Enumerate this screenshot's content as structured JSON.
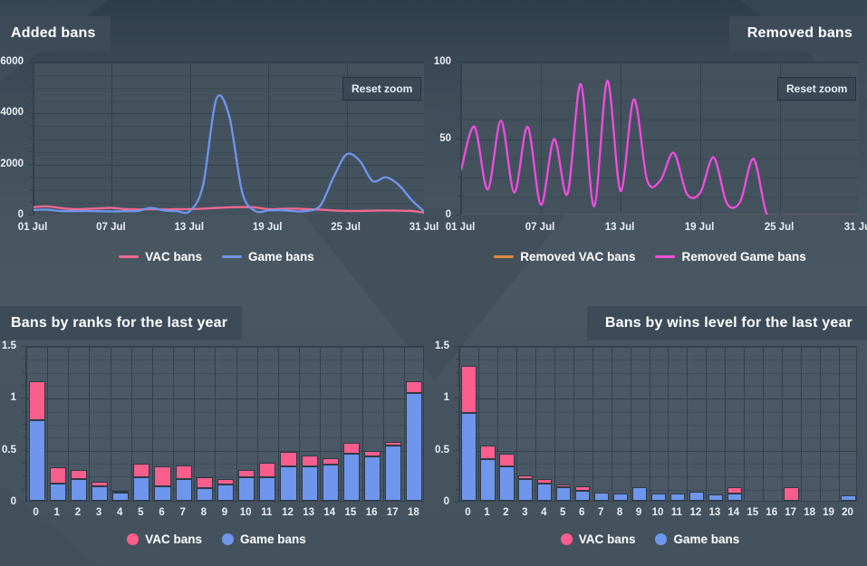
{
  "theme": {
    "page_bg": "#46545f",
    "panel_title_bg": "#3d4b59",
    "plot_bg_line": "#44525e",
    "plot_bg_bar": "#4b5966",
    "grid": "#33414e",
    "text": "#ffffff",
    "vac_color": "#f4traits",
    "colors": {
      "vac_line": "#f2698f",
      "game_line": "#6e96ed",
      "removed_vac_line": "#e08a3c",
      "removed_game_line": "#f24ce0",
      "vac_bar": "#fa5e8c",
      "game_bar": "#6e96ed"
    }
  },
  "panels": {
    "added_bans": {
      "title": "Added bans",
      "title_align": "left",
      "reset_button": "Reset zoom"
    },
    "removed_bans": {
      "title": "Removed bans",
      "title_align": "right",
      "reset_button": "Reset zoom"
    },
    "bans_by_ranks": {
      "title": "Bans by ranks for the last year",
      "title_align": "left"
    },
    "bans_by_wins": {
      "title": "Bans by wins level for the last year",
      "title_align": "right"
    }
  },
  "chart_data": [
    {
      "id": "added_bans",
      "type": "line",
      "title": "Added bans",
      "xlabel": "",
      "ylabel": "",
      "ylim": [
        0,
        6000
      ],
      "yticks": [
        0,
        2000,
        4000,
        6000
      ],
      "ytick_labels": [
        "0",
        "2000",
        "4000",
        "6000"
      ],
      "y_minor_step": 500,
      "xticks": [
        1,
        7,
        13,
        19,
        25,
        31
      ],
      "xtick_labels": [
        "01 Jul",
        "07 Jul",
        "13 Jul",
        "19 Jul",
        "25 Jul",
        "31 Jul"
      ],
      "grid": true,
      "legend_position": "bottom",
      "legend_marker": "line",
      "x": [
        1,
        2,
        3,
        4,
        5,
        6,
        7,
        8,
        9,
        10,
        11,
        12,
        13,
        14,
        15,
        16,
        17,
        18,
        19,
        20,
        21,
        22,
        23,
        24,
        25,
        26,
        27,
        28,
        29,
        30,
        31
      ],
      "series": [
        {
          "name": "VAC bans",
          "color": "#f2698f",
          "values": [
            330,
            360,
            300,
            250,
            260,
            280,
            300,
            250,
            240,
            250,
            240,
            250,
            250,
            270,
            300,
            320,
            330,
            320,
            250,
            260,
            270,
            250,
            230,
            200,
            180,
            180,
            190,
            200,
            190,
            180,
            110
          ]
        },
        {
          "name": "Game bans",
          "color": "#6e96ed",
          "values": [
            220,
            230,
            180,
            170,
            180,
            170,
            160,
            170,
            180,
            300,
            200,
            170,
            180,
            1200,
            4550,
            3900,
            900,
            180,
            200,
            210,
            170,
            180,
            400,
            1500,
            2400,
            2150,
            1350,
            1500,
            1200,
            600,
            130
          ]
        }
      ]
    },
    {
      "id": "removed_bans",
      "type": "line",
      "title": "Removed bans",
      "xlabel": "",
      "ylabel": "",
      "ylim": [
        0,
        100
      ],
      "yticks": [
        0,
        50,
        100
      ],
      "ytick_labels": [
        "0",
        "50",
        "100"
      ],
      "y_minor_step": 12.5,
      "xticks": [
        1,
        7,
        13,
        19,
        25,
        31
      ],
      "xtick_labels": [
        "01 Jul",
        "07 Jul",
        "13 Jul",
        "19 Jul",
        "25 Jul",
        "31 Jul"
      ],
      "grid": true,
      "legend_position": "bottom",
      "legend_marker": "line",
      "x": [
        1,
        2,
        3,
        4,
        5,
        6,
        7,
        8,
        9,
        10,
        11,
        12,
        13,
        14,
        15,
        16,
        17,
        18,
        19,
        20,
        21,
        22,
        23,
        24,
        25,
        26,
        27,
        28,
        29,
        30,
        31
      ],
      "series": [
        {
          "name": "Removed VAC bans",
          "color": "#e08a3c",
          "values": [
            0,
            0,
            0,
            0,
            0,
            0,
            0,
            0,
            0,
            0,
            0,
            0,
            0,
            0,
            0,
            0,
            0,
            0,
            0,
            0,
            0,
            0,
            0,
            0,
            0,
            0,
            0,
            0,
            0,
            0,
            0
          ]
        },
        {
          "name": "Removed Game bans",
          "color": "#f24ce0",
          "values": [
            30,
            58,
            17,
            62,
            15,
            58,
            7,
            50,
            14,
            86,
            6,
            88,
            16,
            76,
            23,
            23,
            41,
            14,
            15,
            38,
            8,
            9,
            37,
            1,
            0,
            0,
            0,
            0,
            0,
            0,
            0
          ]
        }
      ]
    },
    {
      "id": "bans_by_ranks",
      "type": "bar",
      "bar_mode": "stacked",
      "title": "Bans by ranks for the last year",
      "xlabel": "",
      "ylabel": "",
      "ylim": [
        0,
        1.5
      ],
      "yticks": [
        0,
        0.5,
        1,
        1.5
      ],
      "ytick_labels": [
        "0",
        "0.5",
        "1",
        "1.5"
      ],
      "y_minor_step": 0.125,
      "grid": true,
      "legend_position": "bottom",
      "legend_marker": "dot",
      "categories": [
        "0",
        "1",
        "2",
        "3",
        "4",
        "5",
        "6",
        "7",
        "8",
        "9",
        "10",
        "11",
        "12",
        "13",
        "14",
        "15",
        "16",
        "17",
        "18"
      ],
      "series": [
        {
          "name": "Game bans",
          "color": "#6e96ed",
          "values": [
            0.78,
            0.17,
            0.21,
            0.14,
            0.08,
            0.23,
            0.14,
            0.21,
            0.12,
            0.16,
            0.23,
            0.23,
            0.33,
            0.33,
            0.35,
            0.45,
            0.43,
            0.53,
            1.04
          ]
        },
        {
          "name": "VAC bans",
          "color": "#fa5e8c",
          "values": [
            0.37,
            0.15,
            0.09,
            0.04,
            0.02,
            0.13,
            0.19,
            0.13,
            0.11,
            0.05,
            0.07,
            0.14,
            0.14,
            0.11,
            0.06,
            0.11,
            0.05,
            0.04,
            0.11
          ]
        }
      ]
    },
    {
      "id": "bans_by_wins",
      "type": "bar",
      "bar_mode": "stacked",
      "title": "Bans by wins level for the last year",
      "xlabel": "",
      "ylabel": "",
      "ylim": [
        0,
        1.5
      ],
      "yticks": [
        0,
        0.5,
        1,
        1.5
      ],
      "ytick_labels": [
        "0",
        "0.5",
        "1",
        "1.5"
      ],
      "y_minor_step": 0.125,
      "grid": true,
      "legend_position": "bottom",
      "legend_marker": "dot",
      "categories": [
        "0",
        "1",
        "2",
        "3",
        "4",
        "5",
        "6",
        "7",
        "8",
        "9",
        "10",
        "11",
        "12",
        "13",
        "14",
        "15",
        "16",
        "17",
        "18",
        "19",
        "20"
      ],
      "series": [
        {
          "name": "Game bans",
          "color": "#6e96ed",
          "values": [
            0.85,
            0.4,
            0.33,
            0.21,
            0.17,
            0.13,
            0.1,
            0.08,
            0.07,
            0.13,
            0.07,
            0.07,
            0.09,
            0.06,
            0.07,
            0,
            0,
            0,
            0,
            0,
            0.05
          ]
        },
        {
          "name": "VAC bans",
          "color": "#fa5e8c",
          "values": [
            0.45,
            0.13,
            0.12,
            0.03,
            0.04,
            0.03,
            0.04,
            0,
            0,
            0,
            0,
            0,
            0,
            0,
            0.06,
            0,
            0,
            0.13,
            0,
            0,
            0
          ]
        }
      ]
    }
  ],
  "legends": {
    "added_bans": [
      {
        "label": "VAC bans",
        "color": "#f2698f",
        "marker": "line"
      },
      {
        "label": "Game bans",
        "color": "#6e96ed",
        "marker": "line"
      }
    ],
    "removed_bans": [
      {
        "label": "Removed VAC bans",
        "color": "#e08a3c",
        "marker": "line"
      },
      {
        "label": "Removed Game bans",
        "color": "#f24ce0",
        "marker": "line"
      }
    ],
    "bans_by_ranks": [
      {
        "label": "VAC bans",
        "color": "#fa5e8c",
        "marker": "dot"
      },
      {
        "label": "Game bans",
        "color": "#6e96ed",
        "marker": "dot"
      }
    ],
    "bans_by_wins": [
      {
        "label": "VAC bans",
        "color": "#fa5e8c",
        "marker": "dot"
      },
      {
        "label": "Game bans",
        "color": "#6e96ed",
        "marker": "dot"
      }
    ]
  }
}
